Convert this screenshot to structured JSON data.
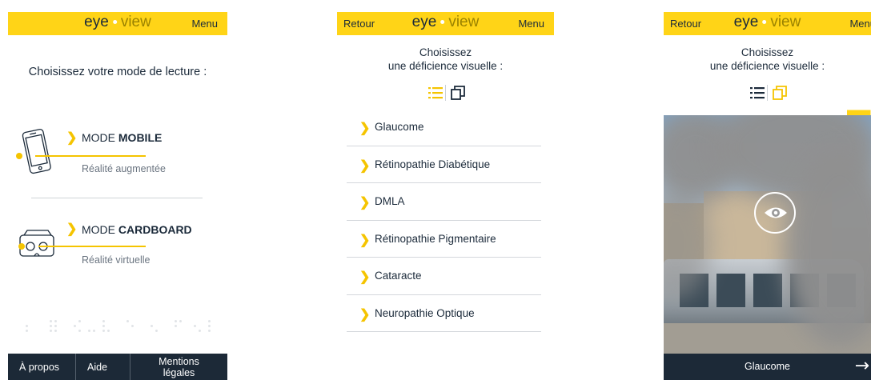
{
  "brand": {
    "word1": "eye",
    "word2": "view"
  },
  "screen1": {
    "menu_label": "Menu",
    "title": "Choisissez votre mode de lecture :",
    "modes": [
      {
        "prefix": "MODE ",
        "bold": "MOBILE",
        "subtitle": "Réalité augmentée",
        "icon": "smartphone-icon"
      },
      {
        "prefix": "MODE ",
        "bold": "CARDBOARD",
        "subtitle": "Réalité virtuelle",
        "icon": "vr-headset-icon"
      }
    ],
    "footer": [
      "À propos",
      "Aide",
      "Mentions légales"
    ]
  },
  "screen2": {
    "back_label": "Retour",
    "menu_label": "Menu",
    "title_line1": "Choisissez",
    "title_line2": "une déficience visuelle :",
    "active_view": "list",
    "deficiencies": [
      "Glaucome",
      "Rétinopathie Diabétique",
      "DMLA",
      "Rétinopathie Pigmentaire",
      "Cataracte",
      "Neuropathie Optique"
    ]
  },
  "screen3": {
    "back_label": "Retour",
    "menu_label": "Menu",
    "title_line1": "Choisissez",
    "title_line2": "une déficience visuelle :",
    "active_view": "cards",
    "card_caption": "Glaucome",
    "next_icon": "arrow-right-icon"
  },
  "colors": {
    "accent": "#ffd417",
    "dark": "#1c2937",
    "text": "#1b2a3a"
  }
}
